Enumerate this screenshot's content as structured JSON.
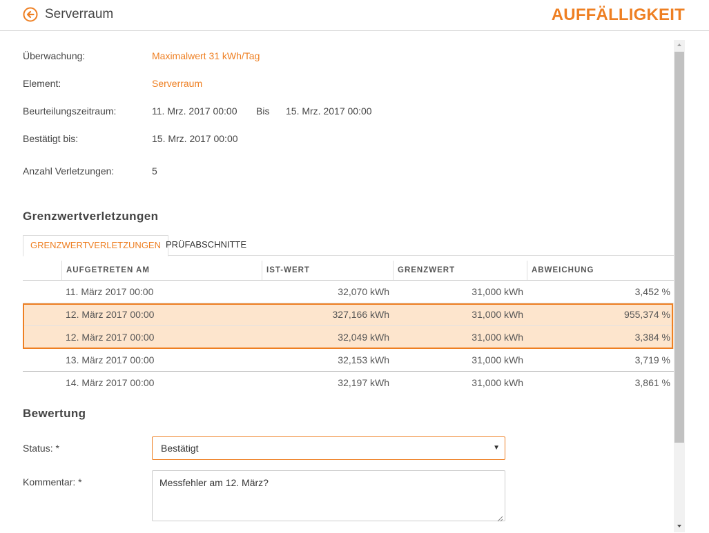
{
  "header": {
    "back_icon": "arrow-left-circle-icon",
    "title": "Serverraum",
    "badge": "AUFFÄLLIGKEIT"
  },
  "info": {
    "monitoring_label": "Überwachung:",
    "monitoring_value": "Maximalwert 31 kWh/Tag",
    "element_label": "Element:",
    "element_value": "Serverraum",
    "period_label": "Beurteilungszeitraum:",
    "period_from": "11. Mrz. 2017 00:00",
    "period_separator": "Bis",
    "period_to": "15. Mrz. 2017 00:00",
    "confirmed_label": "Bestätigt bis:",
    "confirmed_value": "15. Mrz. 2017 00:00",
    "violations_label": "Anzahl Verletzungen:",
    "violations_value": "5"
  },
  "violations_section": {
    "title": "Grenzwertverletzungen",
    "tabs": [
      {
        "label": "GRENZWERTVERLETZUNGEN",
        "active": true
      },
      {
        "label": "PRÜFABSCHNITTE",
        "active": false
      }
    ],
    "columns": [
      "AUFGETRETEN AM",
      "IST-WERT",
      "GRENZWERT",
      "ABWEICHUNG"
    ],
    "rows": [
      {
        "date": "11. März 2017 00:00",
        "actual": "32,070 kWh",
        "limit": "31,000 kWh",
        "deviation": "3,452 %",
        "highlighted": false
      },
      {
        "date": "12. März 2017 00:00",
        "actual": "327,166 kWh",
        "limit": "31,000 kWh",
        "deviation": "955,374 %",
        "highlighted": true
      },
      {
        "date": "12. März 2017 00:00",
        "actual": "32,049 kWh",
        "limit": "31,000 kWh",
        "deviation": "3,384 %",
        "highlighted": true
      },
      {
        "date": "13. März 2017 00:00",
        "actual": "32,153 kWh",
        "limit": "31,000 kWh",
        "deviation": "3,719 %",
        "highlighted": false
      },
      {
        "date": "14. März 2017 00:00",
        "actual": "32,197 kWh",
        "limit": "31,000 kWh",
        "deviation": "3,861 %",
        "highlighted": false
      }
    ],
    "highlight_color": "#fde5cd"
  },
  "assessment": {
    "title": "Bewertung",
    "status_label": "Status: *",
    "status_value": "Bestätigt",
    "comment_label": "Kommentar: *",
    "comment_value": "Messfehler am 12. März?"
  },
  "colors": {
    "accent": "#ee7f22",
    "text": "#444444"
  }
}
